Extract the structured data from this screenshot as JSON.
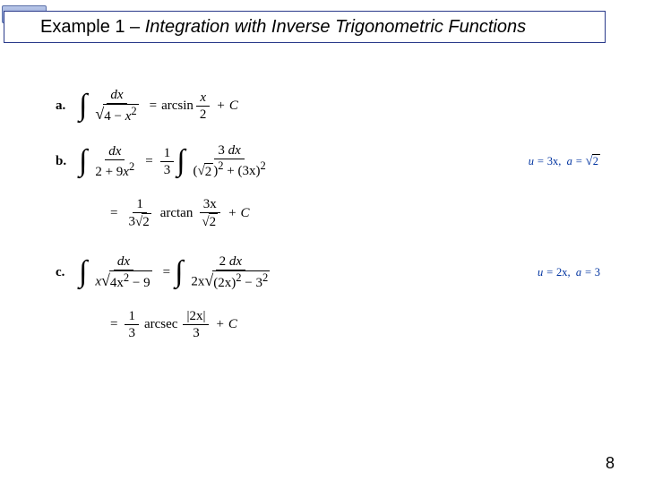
{
  "title": {
    "prefix": "Example 1 – ",
    "italic": "Integration with Inverse Trigonometric Functions"
  },
  "a": {
    "label": "a.",
    "lhs_num": "dx",
    "lhs_den_a": "4",
    "lhs_den_b": "x",
    "lhs_den_exp": "2",
    "eq": "=",
    "rhs_fn": "arcsin",
    "rhs_num": "x",
    "rhs_den": "2",
    "plus": "+",
    "C": "C"
  },
  "b": {
    "label": "b.",
    "lhs_num": "dx",
    "lhs_den_a": "2",
    "lhs_den_b": "9",
    "lhs_den_c": "x",
    "lhs_den_exp": "2",
    "eq": "=",
    "coef_num": "1",
    "coef_den": "3",
    "r1_num_a": "3",
    "r1_num_b": "dx",
    "r1_den_rt": "2",
    "r1_den_b": "(3x)",
    "r1_exp": "2",
    "note_u": "u",
    "note_uval": "3x",
    "note_a": "a",
    "note_aval": "2",
    "line2_coef_num": "1",
    "line2_coef_den_a": "3",
    "line2_coef_den_rt": "2",
    "line2_fn": "arctan",
    "line2_num_a": "3x",
    "line2_den_rt": "2",
    "plus": "+",
    "C": "C"
  },
  "c": {
    "label": "c.",
    "lhs_num": "dx",
    "lhs_den_x": "x",
    "lhs_den_a": "4x",
    "lhs_den_exp1": "2",
    "lhs_den_b": "9",
    "eq": "=",
    "r1_num_a": "2",
    "r1_num_b": "dx",
    "r1_den_a": "2x",
    "r1_den_b": "(2x)",
    "r1_exp": "2",
    "r1_den_c": "3",
    "r1_exp2": "2",
    "note_u": "u",
    "note_uval": "2x",
    "note_a": "a",
    "note_aval": "3",
    "line2_coef_num": "1",
    "line2_coef_den": "3",
    "line2_fn": "arcsec",
    "line2_num": "|2x|",
    "line2_den": "3",
    "plus": "+",
    "C": "C"
  },
  "pagenum": "8"
}
